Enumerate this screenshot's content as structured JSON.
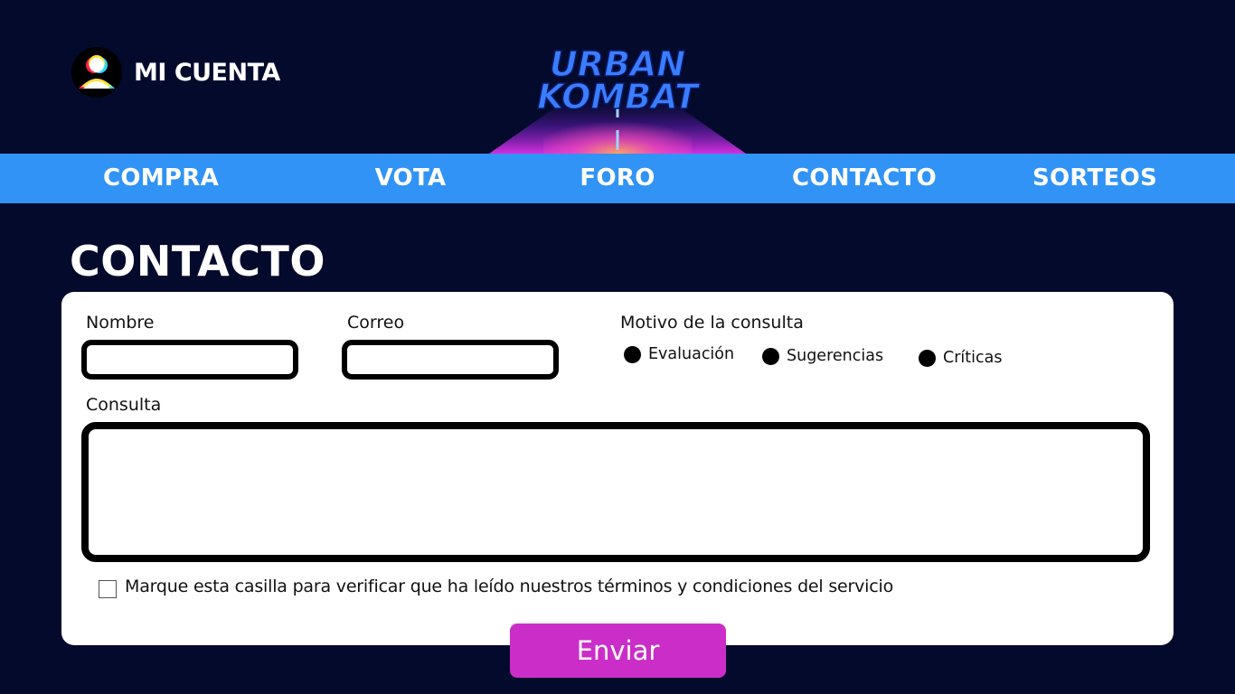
{
  "account": {
    "label": "MI CUENTA",
    "icon": "user-icon"
  },
  "logo": {
    "line1": "URBAN",
    "line2": "KOMBAT"
  },
  "nav": {
    "items": [
      {
        "label": "COMPRA"
      },
      {
        "label": "VOTA"
      },
      {
        "label": "FORO"
      },
      {
        "label": "CONTACTO"
      },
      {
        "label": "SORTEOS"
      }
    ]
  },
  "page": {
    "title": "CONTACTO"
  },
  "form": {
    "name_label": "Nombre",
    "name_value": "",
    "email_label": "Correo",
    "email_value": "",
    "reason_label": "Motivo de la consulta",
    "reasons": [
      {
        "label": "Evaluación"
      },
      {
        "label": "Sugerencias"
      },
      {
        "label": "Críticas"
      }
    ],
    "query_label": "Consulta",
    "query_value": "",
    "terms_text": "Marque esta casilla para verificar que ha leído nuestros términos y condiciones del servicio",
    "terms_checked": false,
    "submit_label": "Enviar"
  },
  "colors": {
    "background": "#040a2c",
    "nav": "#3193f5",
    "submit": "#cb2ec8",
    "card": "#ffffff"
  }
}
